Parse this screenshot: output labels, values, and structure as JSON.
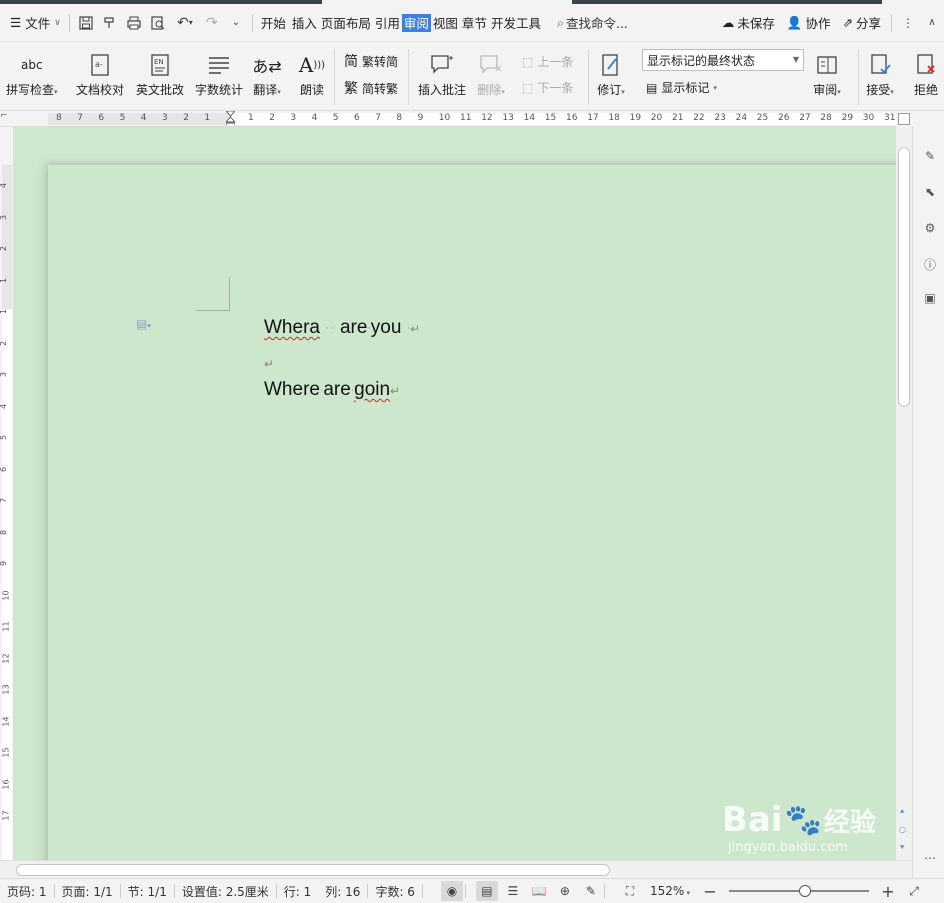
{
  "menubar": {
    "file_label": "文件",
    "tabs": [
      "开始",
      "插入",
      "页面布局",
      "引用",
      "审阅",
      "视图",
      "章节",
      "开发工具"
    ],
    "active_tab": "审阅",
    "search_label": "查找命令...",
    "unsaved_label": "未保存",
    "collab_label": "协作",
    "share_label": "分享"
  },
  "ribbon": {
    "spell_check": "拼写检查",
    "doc_proof": "文档校对",
    "en_review": "英文批改",
    "word_count": "字数统计",
    "translate": "翻译",
    "read_aloud": "朗读",
    "to_simplified": "繁转简",
    "to_traditional": "简转繁",
    "insert_comment": "插入批注",
    "delete": "删除",
    "prev": "上一条",
    "next": "下一条",
    "track": "修订",
    "markup_state": "显示标记的最终状态",
    "show_markup": "显示标记",
    "review": "审阅",
    "accept": "接受",
    "reject": "拒绝"
  },
  "ruler": {
    "left_ticks": [
      "8",
      "7",
      "6",
      "5",
      "4",
      "3",
      "2",
      "1"
    ],
    "right_ticks": [
      "1",
      "2",
      "3",
      "4",
      "5",
      "6",
      "7",
      "8",
      "9",
      "10",
      "11",
      "12",
      "13",
      "14",
      "15",
      "16",
      "17",
      "18",
      "19",
      "20",
      "21",
      "22",
      "23",
      "24",
      "25",
      "26",
      "27",
      "28",
      "29",
      "30",
      "31"
    ],
    "vertical_ticks": [
      "4",
      "3",
      "2",
      "1",
      "1",
      "2",
      "3",
      "4",
      "5",
      "6",
      "7",
      "8",
      "9",
      "10",
      "11",
      "12",
      "13",
      "14",
      "15",
      "16",
      "17"
    ]
  },
  "document": {
    "line1_word1": "Whera",
    "line1_word2": "are",
    "line1_word3": "you",
    "line3_word1": "Where",
    "line3_word2": "are",
    "line3_word3": "goin"
  },
  "status": {
    "page_num": "页码: 1",
    "pages": "页面: 1/1",
    "section": "节: 1/1",
    "setting": "设置值: 2.5厘米",
    "row": "行: 1",
    "col": "列: 16",
    "word_count": "字数: 6",
    "zoom": "152%"
  },
  "watermark": {
    "brand": "Bai",
    "brand_cn": "经验",
    "url": "jingyan.baidu.com"
  },
  "colors": {
    "active_tab": "#3e7fe0",
    "page_bg": "#cde7cc",
    "spell_error": "#dd2222"
  }
}
